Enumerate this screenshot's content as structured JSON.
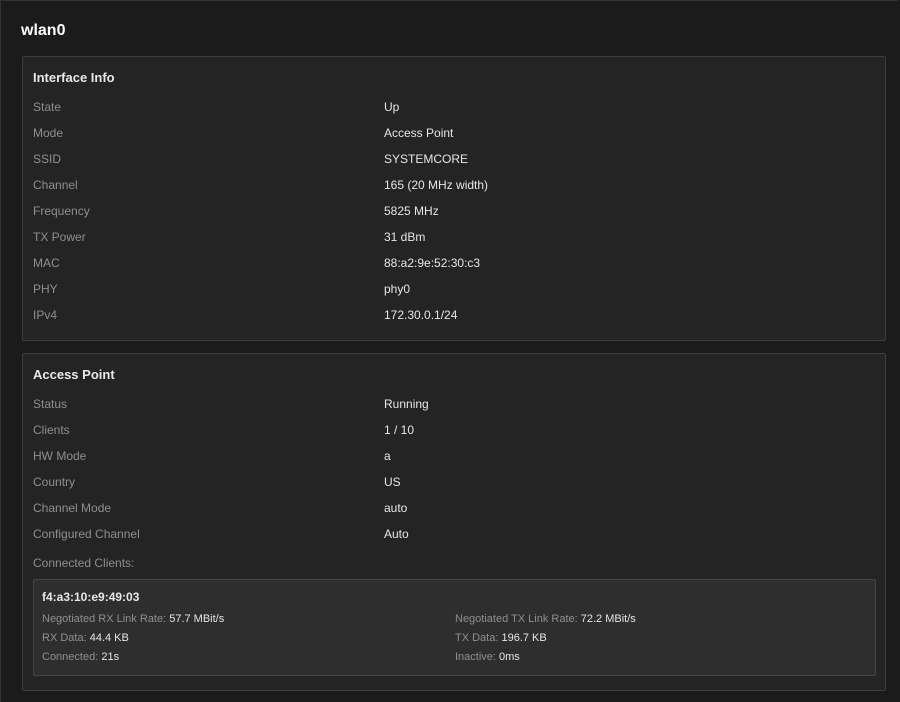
{
  "page": {
    "title": "wlan0"
  },
  "interface_info": {
    "title": "Interface Info",
    "rows": [
      {
        "label": "State",
        "value": "Up"
      },
      {
        "label": "Mode",
        "value": "Access Point"
      },
      {
        "label": "SSID",
        "value": "SYSTEMCORE"
      },
      {
        "label": "Channel",
        "value": "165 (20 MHz width)"
      },
      {
        "label": "Frequency",
        "value": "5825 MHz"
      },
      {
        "label": "TX Power",
        "value": "31 dBm"
      },
      {
        "label": "MAC",
        "value": "88:a2:9e:52:30:c3"
      },
      {
        "label": "PHY",
        "value": "phy0"
      },
      {
        "label": "IPv4",
        "value": "172.30.0.1/24"
      }
    ]
  },
  "access_point": {
    "title": "Access Point",
    "rows": [
      {
        "label": "Status",
        "value": "Running"
      },
      {
        "label": "Clients",
        "value": "1 / 10"
      },
      {
        "label": "HW Mode",
        "value": "a"
      },
      {
        "label": "Country",
        "value": "US"
      },
      {
        "label": "Channel Mode",
        "value": "auto"
      },
      {
        "label": "Configured Channel",
        "value": "Auto"
      }
    ],
    "connected_clients_label": "Connected Clients:",
    "clients": [
      {
        "mac": "f4:a3:10:e9:49:03",
        "rx_rate_label": "Negotiated RX Link Rate:",
        "rx_rate": "57.7 MBit/s",
        "tx_rate_label": "Negotiated TX Link Rate:",
        "tx_rate": "72.2 MBit/s",
        "rx_data_label": "RX Data:",
        "rx_data": "44.4 KB",
        "tx_data_label": "TX Data:",
        "tx_data": "196.7 KB",
        "connected_label": "Connected:",
        "connected": "21s",
        "inactive_label": "Inactive:",
        "inactive": "0ms"
      }
    ]
  }
}
